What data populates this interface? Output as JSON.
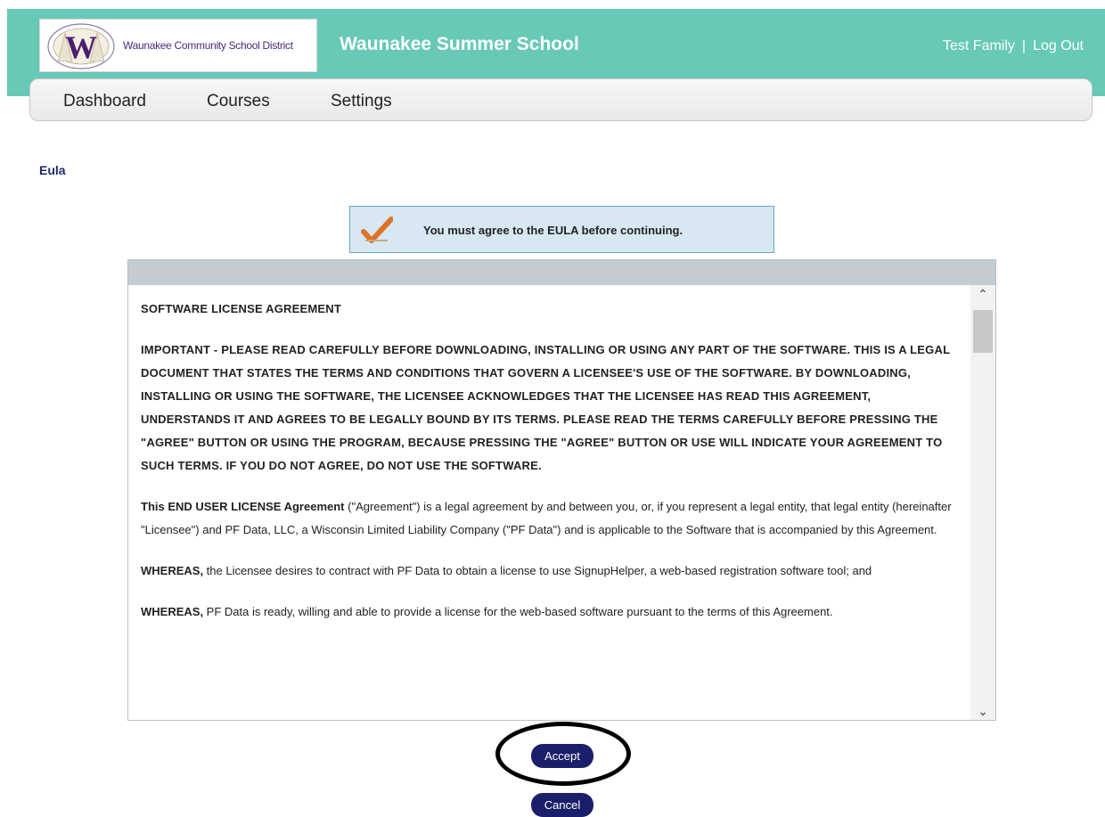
{
  "header": {
    "logo_text": "Waunakee Community School District",
    "app_title": "Waunakee Summer School",
    "user_name": "Test Family",
    "separator": "|",
    "logout_label": "Log Out"
  },
  "nav": {
    "items": [
      {
        "label": "Dashboard"
      },
      {
        "label": "Courses"
      },
      {
        "label": "Settings"
      }
    ]
  },
  "page": {
    "heading": "Eula",
    "notice": "You must agree to the EULA before continuing.",
    "notice_icon": "checkmark-icon"
  },
  "eula": {
    "title": "SOFTWARE LICENSE AGREEMENT",
    "important": "IMPORTANT - PLEASE READ CAREFULLY BEFORE DOWNLOADING, INSTALLING OR USING ANY PART OF THE SOFTWARE. THIS IS A LEGAL DOCUMENT THAT STATES THE TERMS AND CONDITIONS THAT GOVERN A LICENSEE'S USE OF THE SOFTWARE. BY DOWNLOADING, INSTALLING OR USING THE SOFTWARE, THE LICENSEE ACKNOWLEDGES THAT THE LICENSEE HAS READ THIS AGREEMENT, UNDERSTANDS IT AND AGREES TO BE LEGALLY BOUND BY ITS TERMS. PLEASE READ THE TERMS CAREFULLY BEFORE PRESSING THE \"AGREE\" BUTTON OR USING THE PROGRAM, BECAUSE PRESSING THE \"AGREE\" BUTTON OR USE WILL INDICATE YOUR AGREEMENT TO SUCH TERMS. IF YOU DO NOT AGREE, DO NOT USE THE SOFTWARE.",
    "para1_bold": "This END USER LICENSE Agreement",
    "para1_rest": " (\"Agreement\") is a legal agreement by and between you, or, if you represent a legal entity, that legal entity (hereinafter \"Licensee\") and PF Data, LLC, a Wisconsin Limited Liability Company (\"PF Data\") and is applicable to the Software that is accompanied by this Agreement.",
    "para2_bold": "WHEREAS,",
    "para2_rest": " the Licensee desires to contract with PF Data to obtain a license to use SignupHelper, a web-based registration software tool; and",
    "para3_bold": "WHEREAS,",
    "para3_rest": " PF Data is ready, willing and able to provide a license for the web-based software pursuant to the terms of this Agreement."
  },
  "actions": {
    "accept_label": "Accept",
    "cancel_label": "Cancel"
  },
  "colors": {
    "header_bg": "#67c9b6",
    "button_bg": "#1b1e6a",
    "notice_bg": "#d7e8f3"
  }
}
